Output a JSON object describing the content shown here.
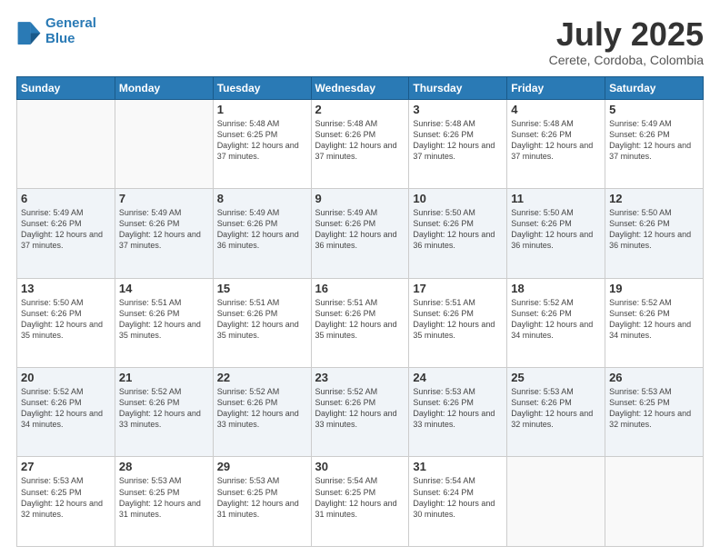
{
  "logo": {
    "line1": "General",
    "line2": "Blue"
  },
  "title": "July 2025",
  "subtitle": "Cerete, Cordoba, Colombia",
  "days_of_week": [
    "Sunday",
    "Monday",
    "Tuesday",
    "Wednesday",
    "Thursday",
    "Friday",
    "Saturday"
  ],
  "weeks": [
    [
      {
        "day": "",
        "sunrise": "",
        "sunset": "",
        "daylight": "",
        "empty": true
      },
      {
        "day": "",
        "sunrise": "",
        "sunset": "",
        "daylight": "",
        "empty": true
      },
      {
        "day": "1",
        "sunrise": "Sunrise: 5:48 AM",
        "sunset": "Sunset: 6:25 PM",
        "daylight": "Daylight: 12 hours and 37 minutes.",
        "empty": false
      },
      {
        "day": "2",
        "sunrise": "Sunrise: 5:48 AM",
        "sunset": "Sunset: 6:26 PM",
        "daylight": "Daylight: 12 hours and 37 minutes.",
        "empty": false
      },
      {
        "day": "3",
        "sunrise": "Sunrise: 5:48 AM",
        "sunset": "Sunset: 6:26 PM",
        "daylight": "Daylight: 12 hours and 37 minutes.",
        "empty": false
      },
      {
        "day": "4",
        "sunrise": "Sunrise: 5:48 AM",
        "sunset": "Sunset: 6:26 PM",
        "daylight": "Daylight: 12 hours and 37 minutes.",
        "empty": false
      },
      {
        "day": "5",
        "sunrise": "Sunrise: 5:49 AM",
        "sunset": "Sunset: 6:26 PM",
        "daylight": "Daylight: 12 hours and 37 minutes.",
        "empty": false
      }
    ],
    [
      {
        "day": "6",
        "sunrise": "Sunrise: 5:49 AM",
        "sunset": "Sunset: 6:26 PM",
        "daylight": "Daylight: 12 hours and 37 minutes.",
        "empty": false
      },
      {
        "day": "7",
        "sunrise": "Sunrise: 5:49 AM",
        "sunset": "Sunset: 6:26 PM",
        "daylight": "Daylight: 12 hours and 37 minutes.",
        "empty": false
      },
      {
        "day": "8",
        "sunrise": "Sunrise: 5:49 AM",
        "sunset": "Sunset: 6:26 PM",
        "daylight": "Daylight: 12 hours and 36 minutes.",
        "empty": false
      },
      {
        "day": "9",
        "sunrise": "Sunrise: 5:49 AM",
        "sunset": "Sunset: 6:26 PM",
        "daylight": "Daylight: 12 hours and 36 minutes.",
        "empty": false
      },
      {
        "day": "10",
        "sunrise": "Sunrise: 5:50 AM",
        "sunset": "Sunset: 6:26 PM",
        "daylight": "Daylight: 12 hours and 36 minutes.",
        "empty": false
      },
      {
        "day": "11",
        "sunrise": "Sunrise: 5:50 AM",
        "sunset": "Sunset: 6:26 PM",
        "daylight": "Daylight: 12 hours and 36 minutes.",
        "empty": false
      },
      {
        "day": "12",
        "sunrise": "Sunrise: 5:50 AM",
        "sunset": "Sunset: 6:26 PM",
        "daylight": "Daylight: 12 hours and 36 minutes.",
        "empty": false
      }
    ],
    [
      {
        "day": "13",
        "sunrise": "Sunrise: 5:50 AM",
        "sunset": "Sunset: 6:26 PM",
        "daylight": "Daylight: 12 hours and 35 minutes.",
        "empty": false
      },
      {
        "day": "14",
        "sunrise": "Sunrise: 5:51 AM",
        "sunset": "Sunset: 6:26 PM",
        "daylight": "Daylight: 12 hours and 35 minutes.",
        "empty": false
      },
      {
        "day": "15",
        "sunrise": "Sunrise: 5:51 AM",
        "sunset": "Sunset: 6:26 PM",
        "daylight": "Daylight: 12 hours and 35 minutes.",
        "empty": false
      },
      {
        "day": "16",
        "sunrise": "Sunrise: 5:51 AM",
        "sunset": "Sunset: 6:26 PM",
        "daylight": "Daylight: 12 hours and 35 minutes.",
        "empty": false
      },
      {
        "day": "17",
        "sunrise": "Sunrise: 5:51 AM",
        "sunset": "Sunset: 6:26 PM",
        "daylight": "Daylight: 12 hours and 35 minutes.",
        "empty": false
      },
      {
        "day": "18",
        "sunrise": "Sunrise: 5:52 AM",
        "sunset": "Sunset: 6:26 PM",
        "daylight": "Daylight: 12 hours and 34 minutes.",
        "empty": false
      },
      {
        "day": "19",
        "sunrise": "Sunrise: 5:52 AM",
        "sunset": "Sunset: 6:26 PM",
        "daylight": "Daylight: 12 hours and 34 minutes.",
        "empty": false
      }
    ],
    [
      {
        "day": "20",
        "sunrise": "Sunrise: 5:52 AM",
        "sunset": "Sunset: 6:26 PM",
        "daylight": "Daylight: 12 hours and 34 minutes.",
        "empty": false
      },
      {
        "day": "21",
        "sunrise": "Sunrise: 5:52 AM",
        "sunset": "Sunset: 6:26 PM",
        "daylight": "Daylight: 12 hours and 33 minutes.",
        "empty": false
      },
      {
        "day": "22",
        "sunrise": "Sunrise: 5:52 AM",
        "sunset": "Sunset: 6:26 PM",
        "daylight": "Daylight: 12 hours and 33 minutes.",
        "empty": false
      },
      {
        "day": "23",
        "sunrise": "Sunrise: 5:52 AM",
        "sunset": "Sunset: 6:26 PM",
        "daylight": "Daylight: 12 hours and 33 minutes.",
        "empty": false
      },
      {
        "day": "24",
        "sunrise": "Sunrise: 5:53 AM",
        "sunset": "Sunset: 6:26 PM",
        "daylight": "Daylight: 12 hours and 33 minutes.",
        "empty": false
      },
      {
        "day": "25",
        "sunrise": "Sunrise: 5:53 AM",
        "sunset": "Sunset: 6:26 PM",
        "daylight": "Daylight: 12 hours and 32 minutes.",
        "empty": false
      },
      {
        "day": "26",
        "sunrise": "Sunrise: 5:53 AM",
        "sunset": "Sunset: 6:25 PM",
        "daylight": "Daylight: 12 hours and 32 minutes.",
        "empty": false
      }
    ],
    [
      {
        "day": "27",
        "sunrise": "Sunrise: 5:53 AM",
        "sunset": "Sunset: 6:25 PM",
        "daylight": "Daylight: 12 hours and 32 minutes.",
        "empty": false
      },
      {
        "day": "28",
        "sunrise": "Sunrise: 5:53 AM",
        "sunset": "Sunset: 6:25 PM",
        "daylight": "Daylight: 12 hours and 31 minutes.",
        "empty": false
      },
      {
        "day": "29",
        "sunrise": "Sunrise: 5:53 AM",
        "sunset": "Sunset: 6:25 PM",
        "daylight": "Daylight: 12 hours and 31 minutes.",
        "empty": false
      },
      {
        "day": "30",
        "sunrise": "Sunrise: 5:54 AM",
        "sunset": "Sunset: 6:25 PM",
        "daylight": "Daylight: 12 hours and 31 minutes.",
        "empty": false
      },
      {
        "day": "31",
        "sunrise": "Sunrise: 5:54 AM",
        "sunset": "Sunset: 6:24 PM",
        "daylight": "Daylight: 12 hours and 30 minutes.",
        "empty": false
      },
      {
        "day": "",
        "sunrise": "",
        "sunset": "",
        "daylight": "",
        "empty": true
      },
      {
        "day": "",
        "sunrise": "",
        "sunset": "",
        "daylight": "",
        "empty": true
      }
    ]
  ]
}
